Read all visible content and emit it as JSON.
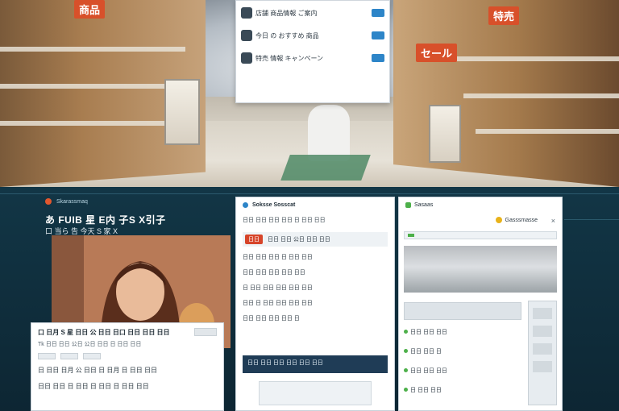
{
  "scene": {
    "signs": [
      "商品",
      "セール",
      "特売"
    ]
  },
  "top_popup": {
    "rows": [
      "店舗 商品情報 ご案内",
      "今日 の おすすめ 商品",
      "特売 情報 キャンペーン"
    ]
  },
  "left_panel": {
    "sub": "Skarassmaq",
    "title": "あ FUIB 星 E内 子S X引子",
    "line2": "口 当ら 告 今天 S 家 X",
    "doc": {
      "head": "口 日月 S 星 日日 公 日日 日口 日日 日日 日日",
      "sub": "Tk 日日 日日 公日 公日 日日 日 日日 日日",
      "body": [
        "日 日日 日月 公 日日 日 日月 日 日日 日日",
        "日日 日日 日 日日 日 日日 日 日日 日日"
      ]
    }
  },
  "middle_panel": {
    "title": "Soksse Sosscat",
    "sub": "日日 日日 日日 日日 日 日日 日日",
    "chip": "日日",
    "bar_text": "日日 日日 公日 日日 日日",
    "paragraphs": [
      "日日 日日 日日 日 日日 日日",
      "日日 日日 日日 日日 日日",
      "日 日日 日日 日日 日日 日日",
      "日日 日 日日 日日 日日 日日",
      "日日 日日 日日 日日 日"
    ],
    "dark": "日日 日日 日日 日日 日日 日日"
  },
  "right_panel": {
    "name": "Sasaas",
    "badge": "Gasssmasse",
    "close": "×",
    "items": [
      "日日 日日 日日",
      "日日 日日 日",
      "日日 日日 日日",
      "日 日日 日日"
    ]
  },
  "colors": {
    "accent_red": "#d7452a",
    "accent_blue": "#2d85c8",
    "accent_green": "#4db04a",
    "dashboard_bg": "#0d2633"
  }
}
